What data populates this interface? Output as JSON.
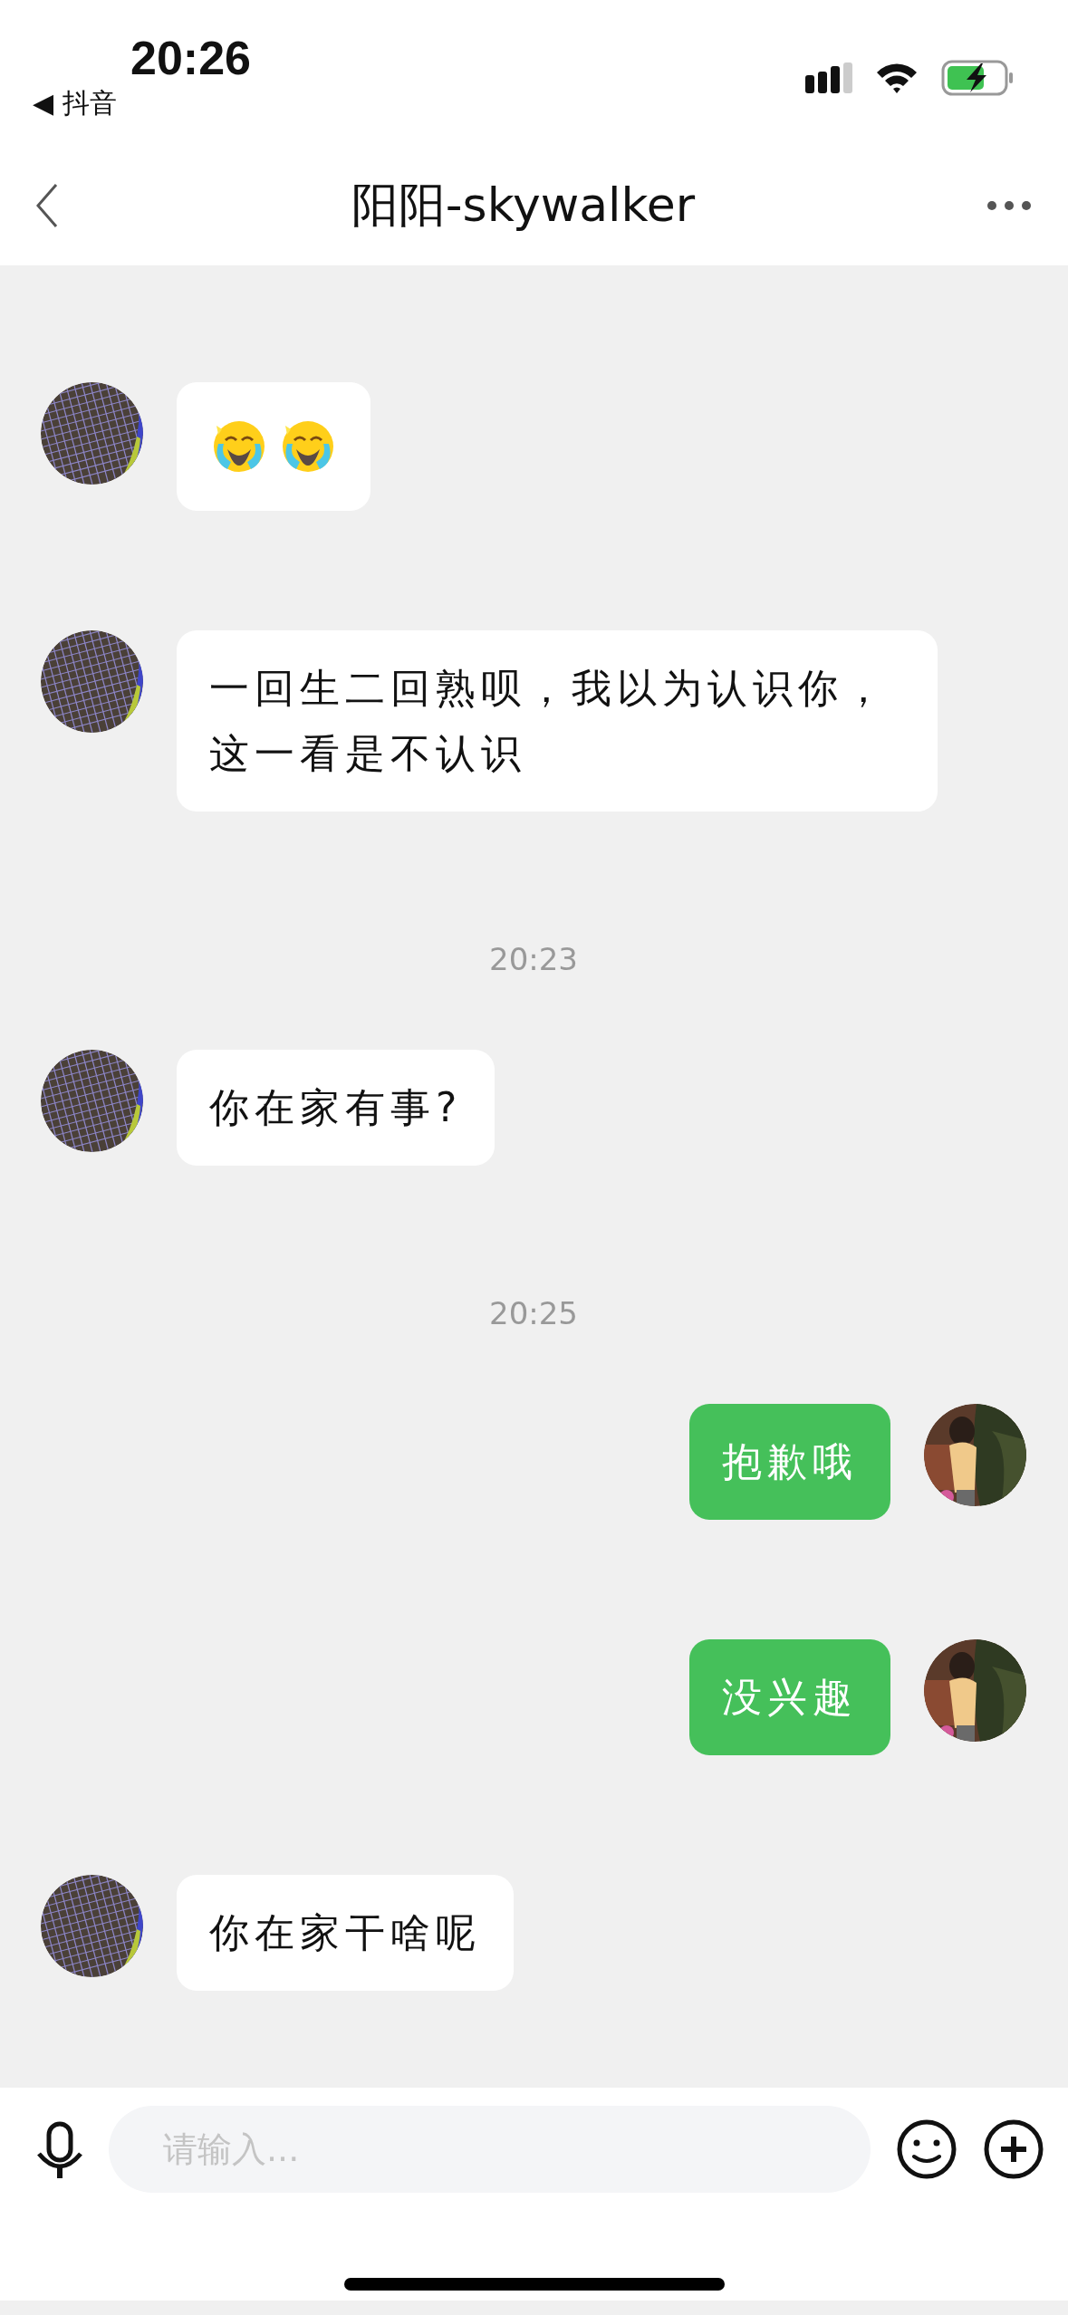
{
  "status_bar": {
    "time": "20:26",
    "back_app": "◀ 抖音"
  },
  "nav": {
    "title": "阳阳-skywalker"
  },
  "messages": [
    {
      "kind": "received",
      "emojis": [
        {
          "kind": "crying"
        },
        {
          "kind": "crying"
        }
      ]
    },
    {
      "kind": "received",
      "text": "一回生二回熟呗，我以为认识你，这一看是不认识"
    },
    {
      "kind": "time",
      "text": "20:23"
    },
    {
      "kind": "received",
      "text": "你在家有事?"
    },
    {
      "kind": "time",
      "text": "20:25"
    },
    {
      "kind": "sent",
      "text": "抱歉哦"
    },
    {
      "kind": "sent",
      "text": "没兴趣"
    },
    {
      "kind": "received",
      "text": "你在家干啥呢"
    }
  ],
  "input": {
    "placeholder": "请输入..."
  }
}
